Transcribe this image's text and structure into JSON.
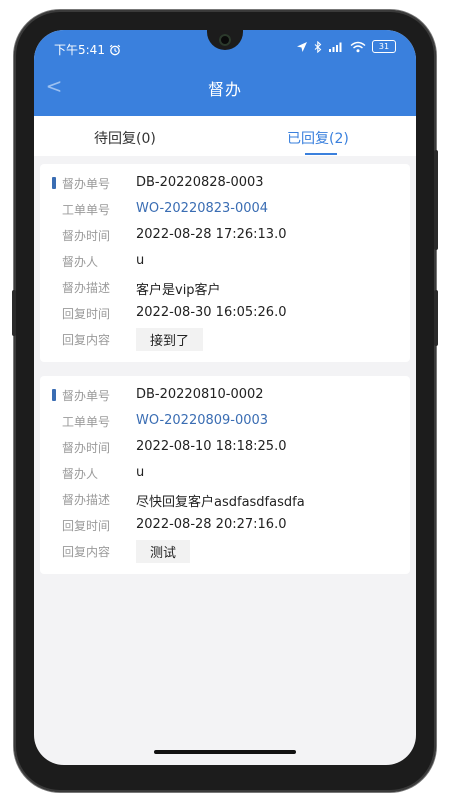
{
  "status_bar": {
    "time": "下午5:41",
    "battery": "31"
  },
  "header": {
    "title": "督办",
    "back_symbol": "<"
  },
  "tabs": [
    {
      "label": "待回复(0)",
      "active": false
    },
    {
      "label": "已回复(2)",
      "active": true
    }
  ],
  "labels": {
    "supervise_no": "督办单号",
    "work_order_no": "工单单号",
    "supervise_time": "督办时间",
    "supervisor": "督办人",
    "description": "督办描述",
    "reply_time": "回复时间",
    "reply_content": "回复内容"
  },
  "records": [
    {
      "supervise_no": "DB-20220828-0003",
      "work_order_no": "WO-20220823-0004",
      "supervise_time": "2022-08-28 17:26:13.0",
      "supervisor": "u",
      "description": "客户是vip客户",
      "reply_time": "2022-08-30 16:05:26.0",
      "reply_content": "接到了"
    },
    {
      "supervise_no": "DB-20220810-0002",
      "work_order_no": "WO-20220809-0003",
      "supervise_time": "2022-08-10 18:18:25.0",
      "supervisor": "u",
      "description": "尽快回复客户asdfasdfasdfa",
      "reply_time": "2022-08-28 20:27:16.0",
      "reply_content": "测试"
    }
  ],
  "colors": {
    "primary": "#3a80dd",
    "link": "#3a6db3",
    "page_bg": "#f3f3f5"
  }
}
